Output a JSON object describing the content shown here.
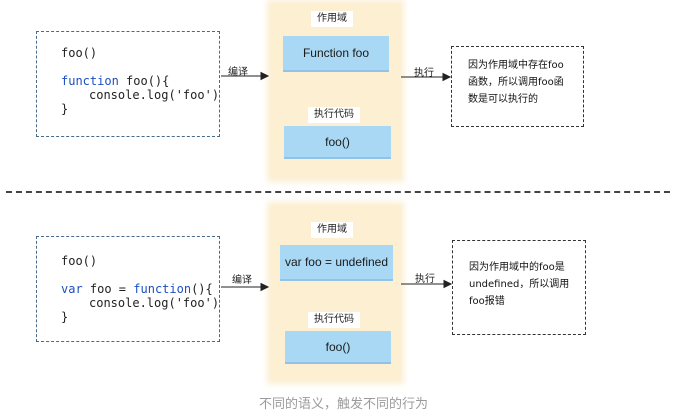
{
  "top": {
    "code": {
      "line1": "foo()",
      "line3_kw": "function",
      "line3_rest": " foo(){",
      "line4": "console.log('foo')",
      "line5": "}"
    },
    "compile_label": "编译",
    "scope_label": "作用域",
    "scope_value": "Function foo",
    "exec_code_label": "执行代码",
    "exec_code_value": "foo()",
    "execute_label": "执行",
    "note_lines": [
      "因为作用域中存在foo",
      "函数，所以调用foo函",
      "数是可以执行的"
    ]
  },
  "bottom": {
    "code": {
      "line1": "foo()",
      "line3_kw": "var",
      "line3_rest": " foo = ",
      "line3_kw2": "function",
      "line3_rest2": "(){",
      "line4": "console.log('foo')",
      "line5": "}"
    },
    "compile_label": "编译",
    "scope_label": "作用域",
    "scope_value": "var foo = undefined",
    "exec_code_label": "执行代码",
    "exec_code_value": "foo()",
    "execute_label": "执行",
    "note_lines": [
      "因为作用域中的foo是",
      "undefined，所以调用",
      "foo报错"
    ]
  },
  "caption": "不同的语义，触发不同的行为"
}
